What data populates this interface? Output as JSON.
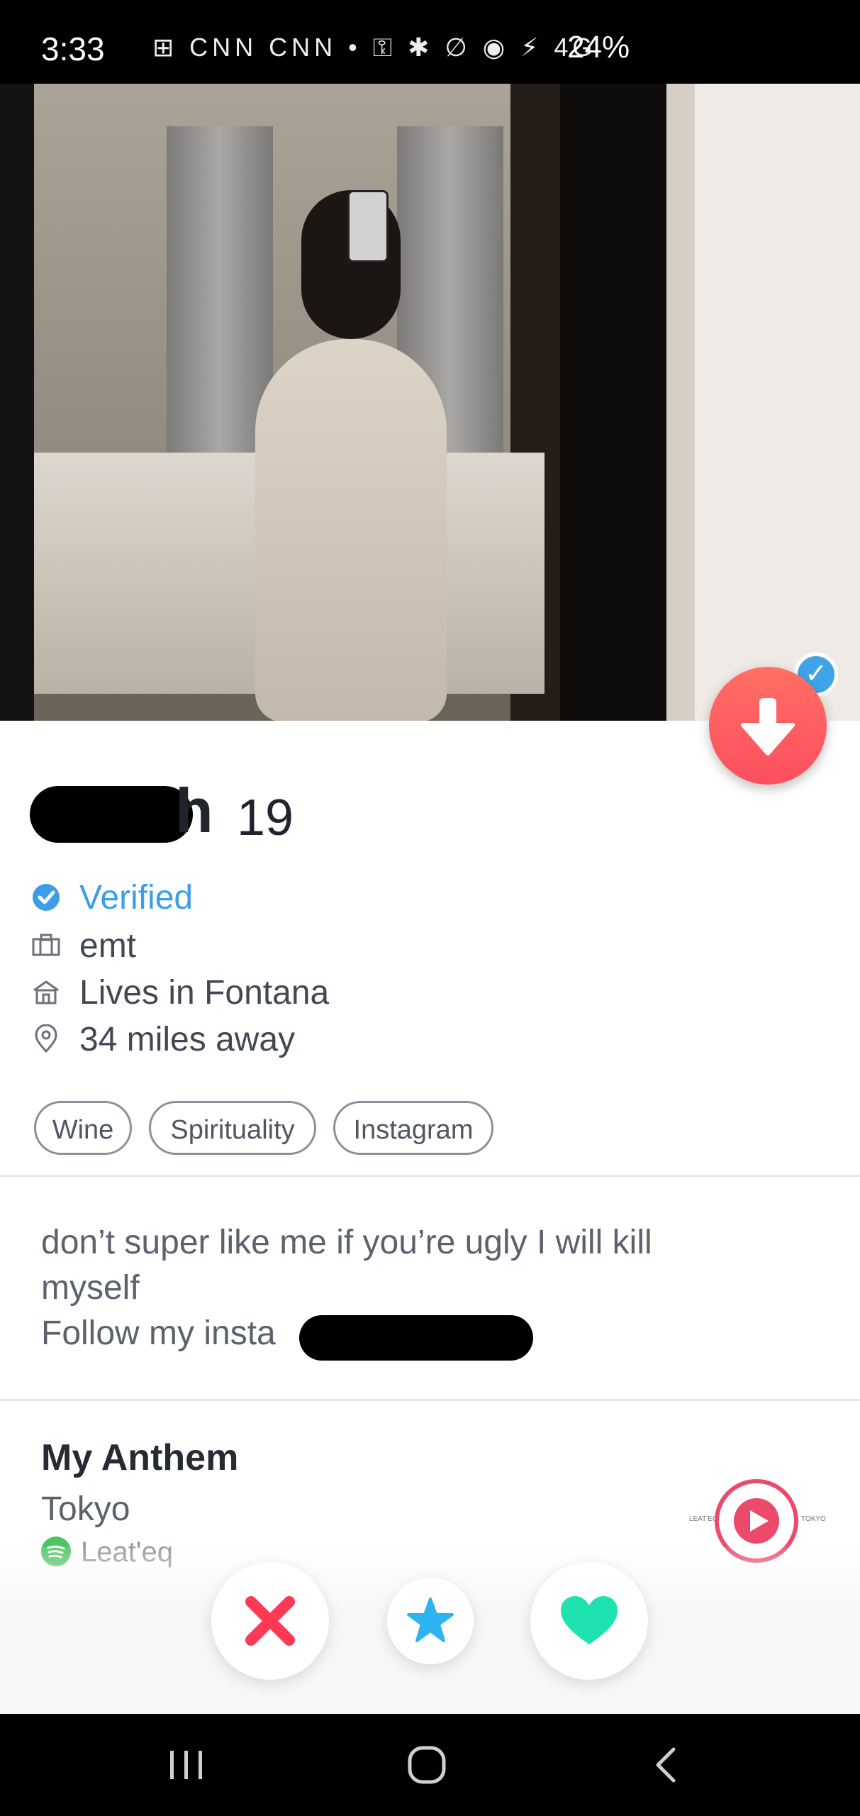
{
  "status_bar": {
    "time": "3:33",
    "icons": "⊞ CNN CNN •   ⚿ ✱ ∅ ◉ ⚡ 4G",
    "battery": "24%"
  },
  "profile": {
    "name_visible": "h",
    "age": "19",
    "verified_label": "Verified",
    "job": "emt",
    "lives_in": "Lives in Fontana",
    "distance": "34 miles away",
    "interests": [
      "Wine",
      "Spirituality",
      "Instagram"
    ],
    "bio_lines": [
      "don’t super like me if you’re ugly I will kill",
      "myself",
      "Follow my insta"
    ]
  },
  "anthem": {
    "title": "My Anthem",
    "song": "Tokyo",
    "artist": "Leat'eq",
    "disc_left_label": "LEAT'EQ",
    "disc_right_label": "TOKYO"
  },
  "colors": {
    "verified_blue": "#3c9ee8",
    "nope_red": "#fd3a55",
    "super_like_blue": "#2fb3f0",
    "like_green": "#1ee3b0",
    "spotify_green": "#4cc463",
    "down_button": "#fd5a5f"
  },
  "icons": {
    "verified": "check-badge-icon",
    "job": "briefcase-icon",
    "home": "house-icon",
    "location": "pin-icon",
    "down": "arrow-down-icon",
    "nope": "x-icon",
    "super_like": "star-icon",
    "like": "heart-icon",
    "play": "play-icon",
    "nav_recent": "recent-apps-icon",
    "nav_home": "home-circle-icon",
    "nav_back": "back-chevron-icon"
  }
}
